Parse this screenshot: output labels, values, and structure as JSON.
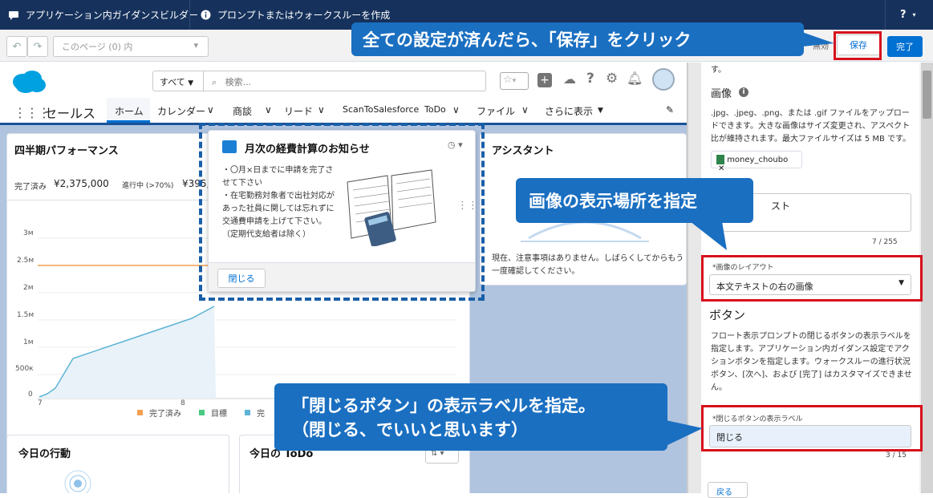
{
  "topbar": {
    "builder_title": "アプリケーション内ガイダンスビルダー",
    "create_label": "プロンプトまたはウォークスルーを作成",
    "help_label": "?"
  },
  "toolbar": {
    "page_select": "このページ (0) 内",
    "status_label": "無効",
    "save_label": "保存",
    "done_label": "完了"
  },
  "sf": {
    "search_scope": "すべて",
    "search_placeholder": "検索...",
    "app_name": "セールス",
    "nav": [
      "ホーム",
      "カレンダー",
      "商談",
      "リード",
      "ScanToSalesforce",
      "ToDo",
      "ファイル",
      "さらに表示"
    ]
  },
  "performance": {
    "title": "四半期パフォーマンス",
    "closed_label": "完了済み",
    "closed_value": "¥2,375,000",
    "open_label": "進行中 (>70%)",
    "open_value": "¥395,",
    "y_ticks": [
      "3м",
      "2.5м",
      "2м",
      "1.5м",
      "1м",
      "500к",
      "0"
    ],
    "x_ticks": [
      "7",
      "8"
    ],
    "legend": [
      "完了済み",
      "目標",
      "完"
    ]
  },
  "prompt": {
    "title": "月次の経費計算のお知らせ",
    "body": "・〇月×日までに申請を完了させて下さい\n・在宅勤務対象者で出社対応があった社員に関しては忘れずに交通費申請を上げて下さい。（定期代支給者は除く）",
    "close_label": "閉じる"
  },
  "assistant": {
    "title": "アシスタント",
    "message": "現在、注意事項はありません。しばらくしてからもう一度確認してください。"
  },
  "today_actions": {
    "title": "今日の行動"
  },
  "today_todo": {
    "title": "今日の ToDo"
  },
  "panel": {
    "top_text": "す。",
    "image_label": "画像",
    "image_help": ".jpg、.jpeg、.png、または .gif ファイルをアップロードできます。大きな画像はサイズ変更され、アスペクト比が維持されます。最大ファイルサイズは 5 MB です。",
    "file_name": "money_choubo",
    "alt_partial": "スト",
    "alt_count": "7 / 255",
    "layout_label": "*画像のレイアウト",
    "layout_value": "本文テキストの右の画像",
    "button_heading": "ボタン",
    "button_help": "フロート表示プロンプトの閉じるボタンの表示ラベルを指定します。アプリケーション内ガイダンス設定でアクションボタンを指定します。ウォークスルーの進行状況ボタン、[次へ]、および [完了] はカスタマイズできません。",
    "close_label_title": "*閉じるボタンの表示ラベル",
    "close_label_value": "閉じる",
    "close_count": "3 / 15",
    "back_label": "戻る"
  },
  "callouts": {
    "save": "全ての設定が済んだら、「保存」をクリック",
    "image_position": "画像の表示場所を指定",
    "close_button_line1": "「閉じるボタン」の表示ラベルを指定。",
    "close_button_line2": "（閉じる、でいいと思います）"
  },
  "colors": {
    "accent": "#0070d2",
    "callout": "#1a6fc1",
    "highlight": "#d7101c",
    "header": "#16325c"
  }
}
